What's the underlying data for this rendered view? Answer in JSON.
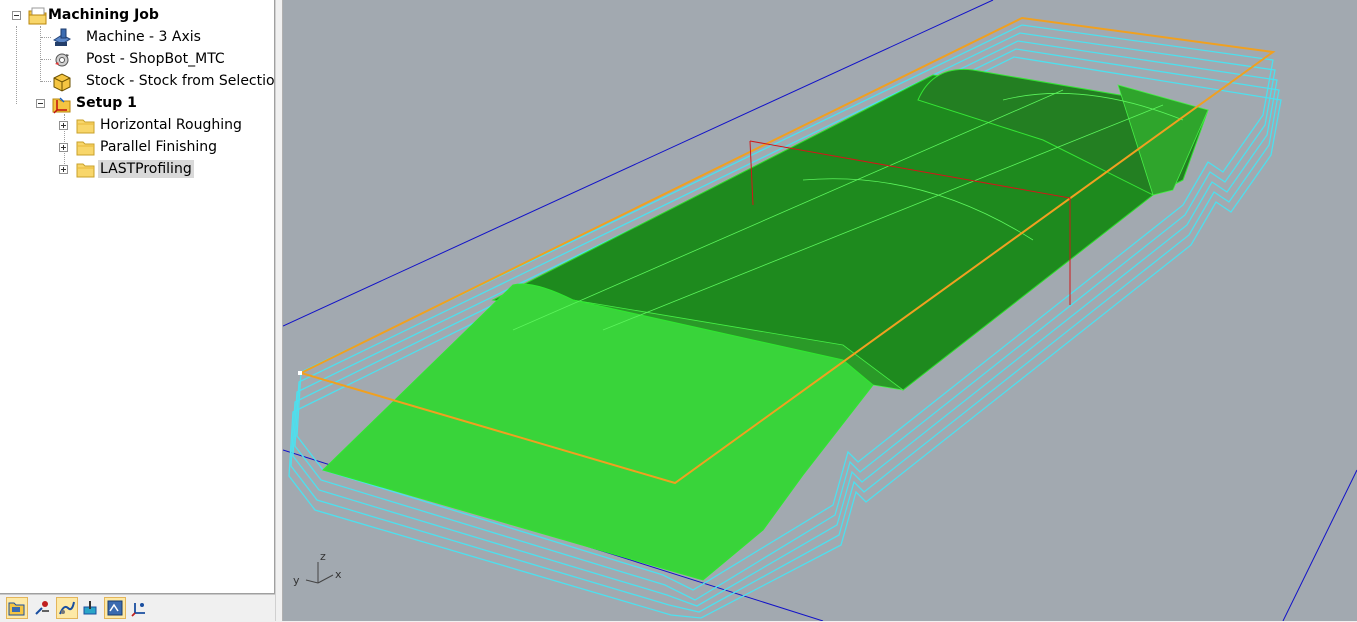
{
  "tree": {
    "root": {
      "label": "Machining Job",
      "expanded": true
    },
    "items": [
      {
        "label": "Machine - 3 Axis",
        "icon": "machine-icon"
      },
      {
        "label": "Post - ShopBot_MTC",
        "icon": "post-icon"
      },
      {
        "label": "Stock - Stock from Selection",
        "icon": "stock-box-icon"
      }
    ],
    "setup": {
      "label": "Setup 1",
      "expanded": true,
      "operations": [
        {
          "label": "Horizontal Roughing",
          "icon": "folder-icon",
          "expanded": false
        },
        {
          "label": "Parallel Finishing",
          "icon": "folder-icon",
          "expanded": false
        },
        {
          "label": "LASTProfiling",
          "icon": "folder-icon",
          "expanded": false,
          "selected": true
        }
      ]
    }
  },
  "toolbar": {
    "buttons": [
      {
        "name": "machining-job-icon",
        "active": true
      },
      {
        "name": "tools-icon",
        "active": false
      },
      {
        "name": "toolpath-icon",
        "active": true
      },
      {
        "name": "simulate-icon",
        "active": false
      },
      {
        "name": "features-icon",
        "active": true
      },
      {
        "name": "setup-axes-icon",
        "active": false
      }
    ]
  },
  "viewport": {
    "axis_labels": {
      "z": "z",
      "x": "x",
      "y": "y"
    },
    "colors": {
      "background": "#a2a9b0",
      "part_surface": "#39d43a",
      "part_dark": "#1e8a1e",
      "toolpath": "#4de0ee",
      "stock_boundary": "#f0a020",
      "grid_line": "#1010c8",
      "red_box": "#d01818"
    }
  }
}
